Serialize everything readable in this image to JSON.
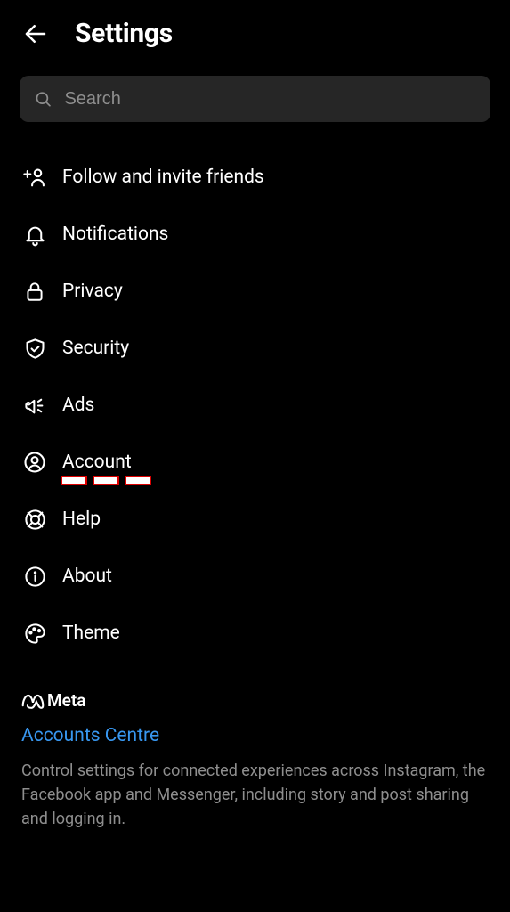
{
  "header": {
    "title": "Settings"
  },
  "search": {
    "placeholder": "Search",
    "value": ""
  },
  "menu": {
    "items": [
      {
        "id": "follow-invite",
        "label": "Follow and invite friends",
        "icon": "person-add"
      },
      {
        "id": "notifications",
        "label": "Notifications",
        "icon": "bell"
      },
      {
        "id": "privacy",
        "label": "Privacy",
        "icon": "lock"
      },
      {
        "id": "security",
        "label": "Security",
        "icon": "shield-check"
      },
      {
        "id": "ads",
        "label": "Ads",
        "icon": "megaphone"
      },
      {
        "id": "account",
        "label": "Account",
        "icon": "user-circle"
      },
      {
        "id": "help",
        "label": "Help",
        "icon": "lifebuoy"
      },
      {
        "id": "about",
        "label": "About",
        "icon": "info"
      },
      {
        "id": "theme",
        "label": "Theme",
        "icon": "palette"
      }
    ]
  },
  "meta": {
    "brand": "Meta",
    "link_label": "Accounts Centre",
    "description": "Control settings for connected experiences across Instagram, the Facebook app and Messenger, including story and post sharing and logging in."
  },
  "colors": {
    "link": "#3897f0",
    "muted": "#8e8e8e",
    "search_bg": "#262626",
    "highlight_border": "#d00"
  }
}
